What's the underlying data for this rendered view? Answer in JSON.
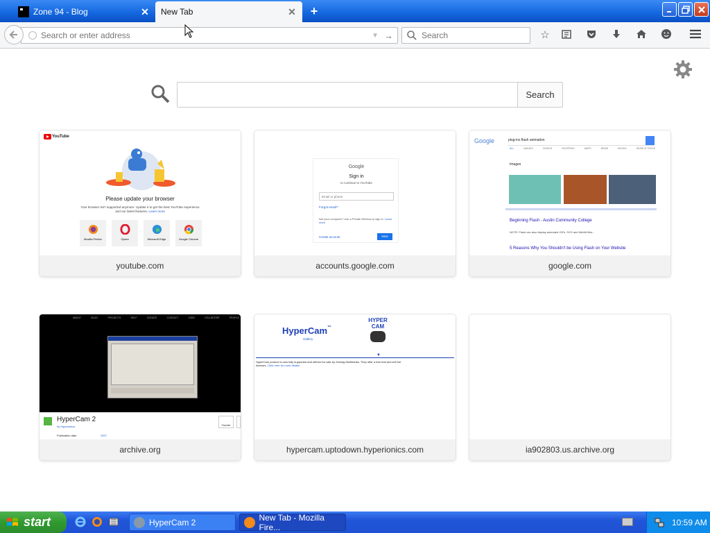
{
  "tabs": [
    {
      "label": "Zone 94 - Blog",
      "active": false
    },
    {
      "label": "New Tab",
      "active": true
    }
  ],
  "navbar": {
    "url_placeholder": "Search or enter address",
    "search_placeholder": "Search"
  },
  "newtab": {
    "search_button": "Search"
  },
  "tiles": [
    {
      "caption": "youtube.com"
    },
    {
      "caption": "accounts.google.com"
    },
    {
      "caption": "google.com"
    },
    {
      "caption": "archive.org"
    },
    {
      "caption": "hypercam.uptodown.hyperionics.com"
    },
    {
      "caption": "ia902803.us.archive.org"
    }
  ],
  "thumbs": {
    "youtube": {
      "logo": "YouTube",
      "heading": "Please update your browser",
      "body": "Your browser isn't supported anymore. Update it to get the best YouTube experience and our latest features.",
      "learn_more": "Learn more",
      "browsers": [
        "Mozilla Firefox",
        "Opera",
        "Microsoft Edge",
        "Google Chrome"
      ]
    },
    "gaccounts": {
      "logo": "Google",
      "title": "Sign in",
      "subtitle": "to continue to YouTube",
      "email": "Email or phone",
      "forgot": "Forgot email?",
      "note": "Not your computer? Use a Private Window to sign in.",
      "learn_more": "Learn more",
      "create": "Create account",
      "next": "Next"
    },
    "gsearch": {
      "logo": "Google",
      "query": "plug-ins flash animation",
      "tabs": [
        "ALL",
        "IMAGES",
        "VIDEOS",
        "SHOPPING",
        "MAPS",
        "NEWS",
        "BOOKS",
        "SEARCH TOOLS"
      ],
      "images_label": "Images",
      "result1": "Beginning Flash - Austin Community College",
      "result1_desc": "NOTE: Flash can also display animated GIFs, SVG and WebM files...",
      "result2": "5 Reasons Why You Shouldn't be Using Flash on Your Website"
    },
    "archive": {
      "nav": [
        "ABOUT",
        "BLOG",
        "PROJECTS",
        "HELP",
        "DONATE",
        "CONTACT",
        "JOBS",
        "VOLUNTEER",
        "PEOPLE"
      ],
      "title": "HyperCam 2",
      "by": "by Hyperionics",
      "published": "Publication date",
      "year": "2007",
      "favorite": "Favorite"
    },
    "hypercam": {
      "logo": "HyperCam",
      "tm": "™",
      "sub": "Gallery",
      "badge": "HYPER CAM",
      "text": "HyperCam product is now fully supported and offered for sale by Solveig Multimedia.",
      "text2": "They offer a free trial and sell full licenses.",
      "link": "Click here for more details"
    }
  },
  "taskbar": {
    "start": "start",
    "items": [
      "HyperCam 2",
      "New Tab - Mozilla Fire..."
    ],
    "clock": "10:59 AM"
  }
}
